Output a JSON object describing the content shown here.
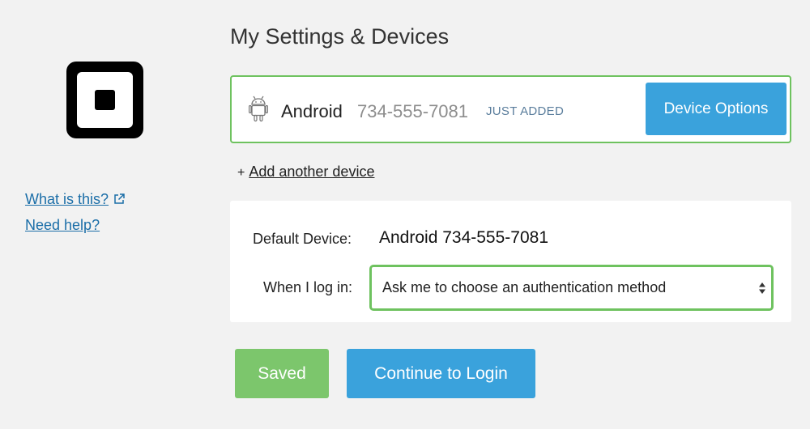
{
  "page": {
    "title": "My Settings & Devices"
  },
  "sidebar": {
    "logo_icon": "square-logo-icon",
    "what_is_this": "What is this?",
    "external_link_icon": "external-link-icon",
    "need_help": "Need help?"
  },
  "device": {
    "icon": "android-icon",
    "name": "Android",
    "phone": "734-555-7081",
    "status": "JUST ADDED",
    "options_label": "Device Options"
  },
  "add_device": {
    "prefix": "+",
    "label": "Add another device"
  },
  "settings": {
    "default_device_label": "Default Device:",
    "default_device_value": "Android 734-555-7081",
    "login_label": "When I log in:",
    "login_method_selected": "Ask me to choose an authentication method"
  },
  "actions": {
    "saved_label": "Saved",
    "continue_label": "Continue to Login"
  },
  "colors": {
    "background": "#f2f2f2",
    "accent_blue": "#3aa2dc",
    "success_green": "#7cc66c",
    "focus_green": "#6ec25f",
    "link_blue": "#1b6ea8"
  }
}
